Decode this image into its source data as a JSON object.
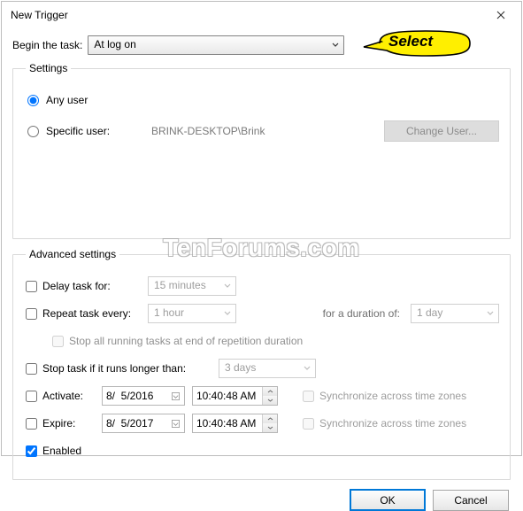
{
  "window": {
    "title": "New Trigger"
  },
  "callout": {
    "label": "Select"
  },
  "watermark": "TenForums.com",
  "begin": {
    "label": "Begin the task:",
    "value": "At log on"
  },
  "settings": {
    "legend": "Settings",
    "any_user": "Any user",
    "specific_user": "Specific user:",
    "user_value": "BRINK-DESKTOP\\Brink",
    "change_user_btn": "Change User..."
  },
  "advanced": {
    "legend": "Advanced settings",
    "delay": {
      "label": "Delay task for:",
      "value": "15 minutes"
    },
    "repeat": {
      "label": "Repeat task every:",
      "value": "1 hour",
      "duration_label": "for a duration of:",
      "duration_value": "1 day",
      "stop_label": "Stop all running tasks at end of repetition duration"
    },
    "stop_if": {
      "label": "Stop task if it runs longer than:",
      "value": "3 days"
    },
    "activate": {
      "label": "Activate:",
      "date": "8/  5/2016",
      "time": "10:40:48 AM",
      "sync": "Synchronize across time zones"
    },
    "expire": {
      "label": "Expire:",
      "date": "8/  5/2017",
      "time": "10:40:48 AM",
      "sync": "Synchronize across time zones"
    },
    "enabled": "Enabled"
  },
  "footer": {
    "ok": "OK",
    "cancel": "Cancel"
  }
}
